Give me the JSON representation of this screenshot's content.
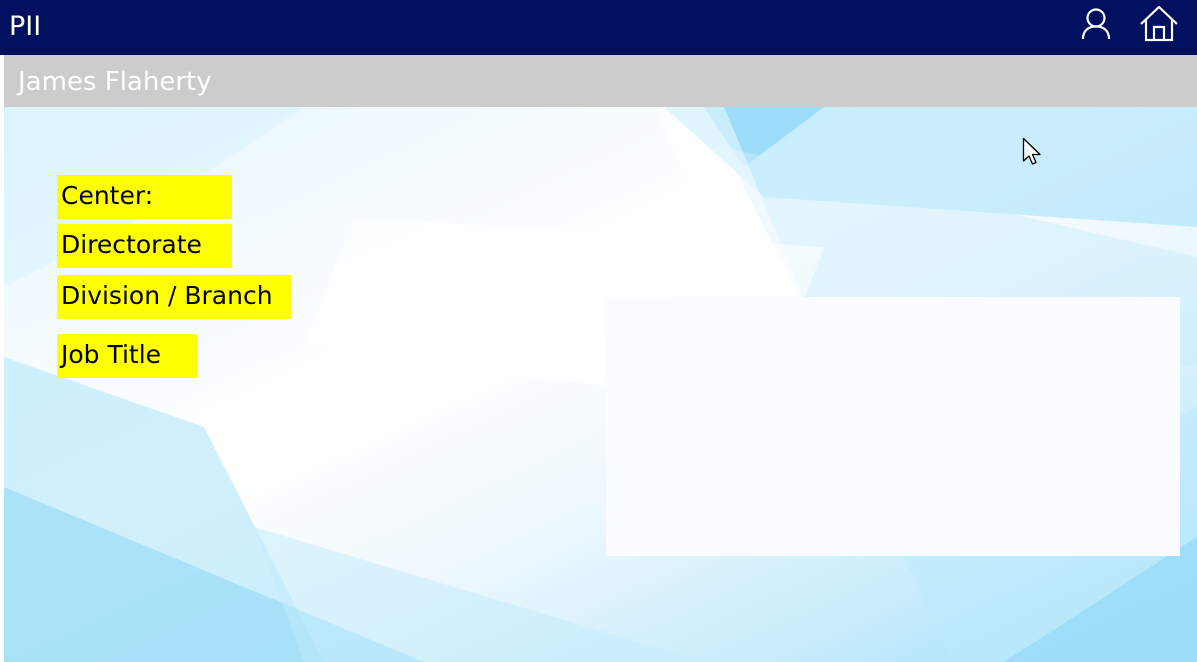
{
  "header": {
    "app_title": "PII",
    "user_icon": "user-icon",
    "home_icon": "home-icon"
  },
  "subheader": {
    "name": "James Flaherty"
  },
  "fields": {
    "center_label": "Center:",
    "directorate_label": "Directorate",
    "division_label": "Division / Branch",
    "job_title_label": "Job Title"
  },
  "colors": {
    "header_bg": "#000f5e",
    "subheader_bg": "#cccccc",
    "label_highlight": "#ffff00"
  }
}
